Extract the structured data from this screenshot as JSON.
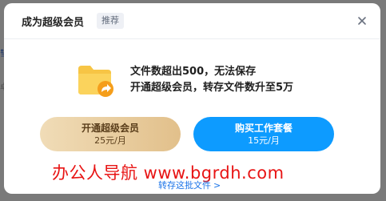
{
  "background": {
    "fragment_1": "彗",
    "fragment_2": "卓"
  },
  "dialog": {
    "title": "成为超级会员",
    "tag": "推荐",
    "close_icon": "close-icon"
  },
  "message": {
    "line1": "文件数超出500，无法保存",
    "line2": "开通超级会员，转存文件数升至5万",
    "icon": "folder-share-icon"
  },
  "buttons": {
    "svip": {
      "label": "开通超级会员",
      "price": "25元/月"
    },
    "work_pack": {
      "label": "购买工作套餐",
      "price": "15元/月"
    }
  },
  "watermark": "办公人导航  www.bgrdh.com",
  "transfer_link": {
    "label": "转存这批文件",
    "chevron": ">"
  },
  "colors": {
    "primary_blue": "#0d9bff",
    "gold_start": "#f0dcb7",
    "gold_end": "#e2c08b",
    "watermark_red": "#e81414",
    "link_blue": "#1a73e8"
  }
}
